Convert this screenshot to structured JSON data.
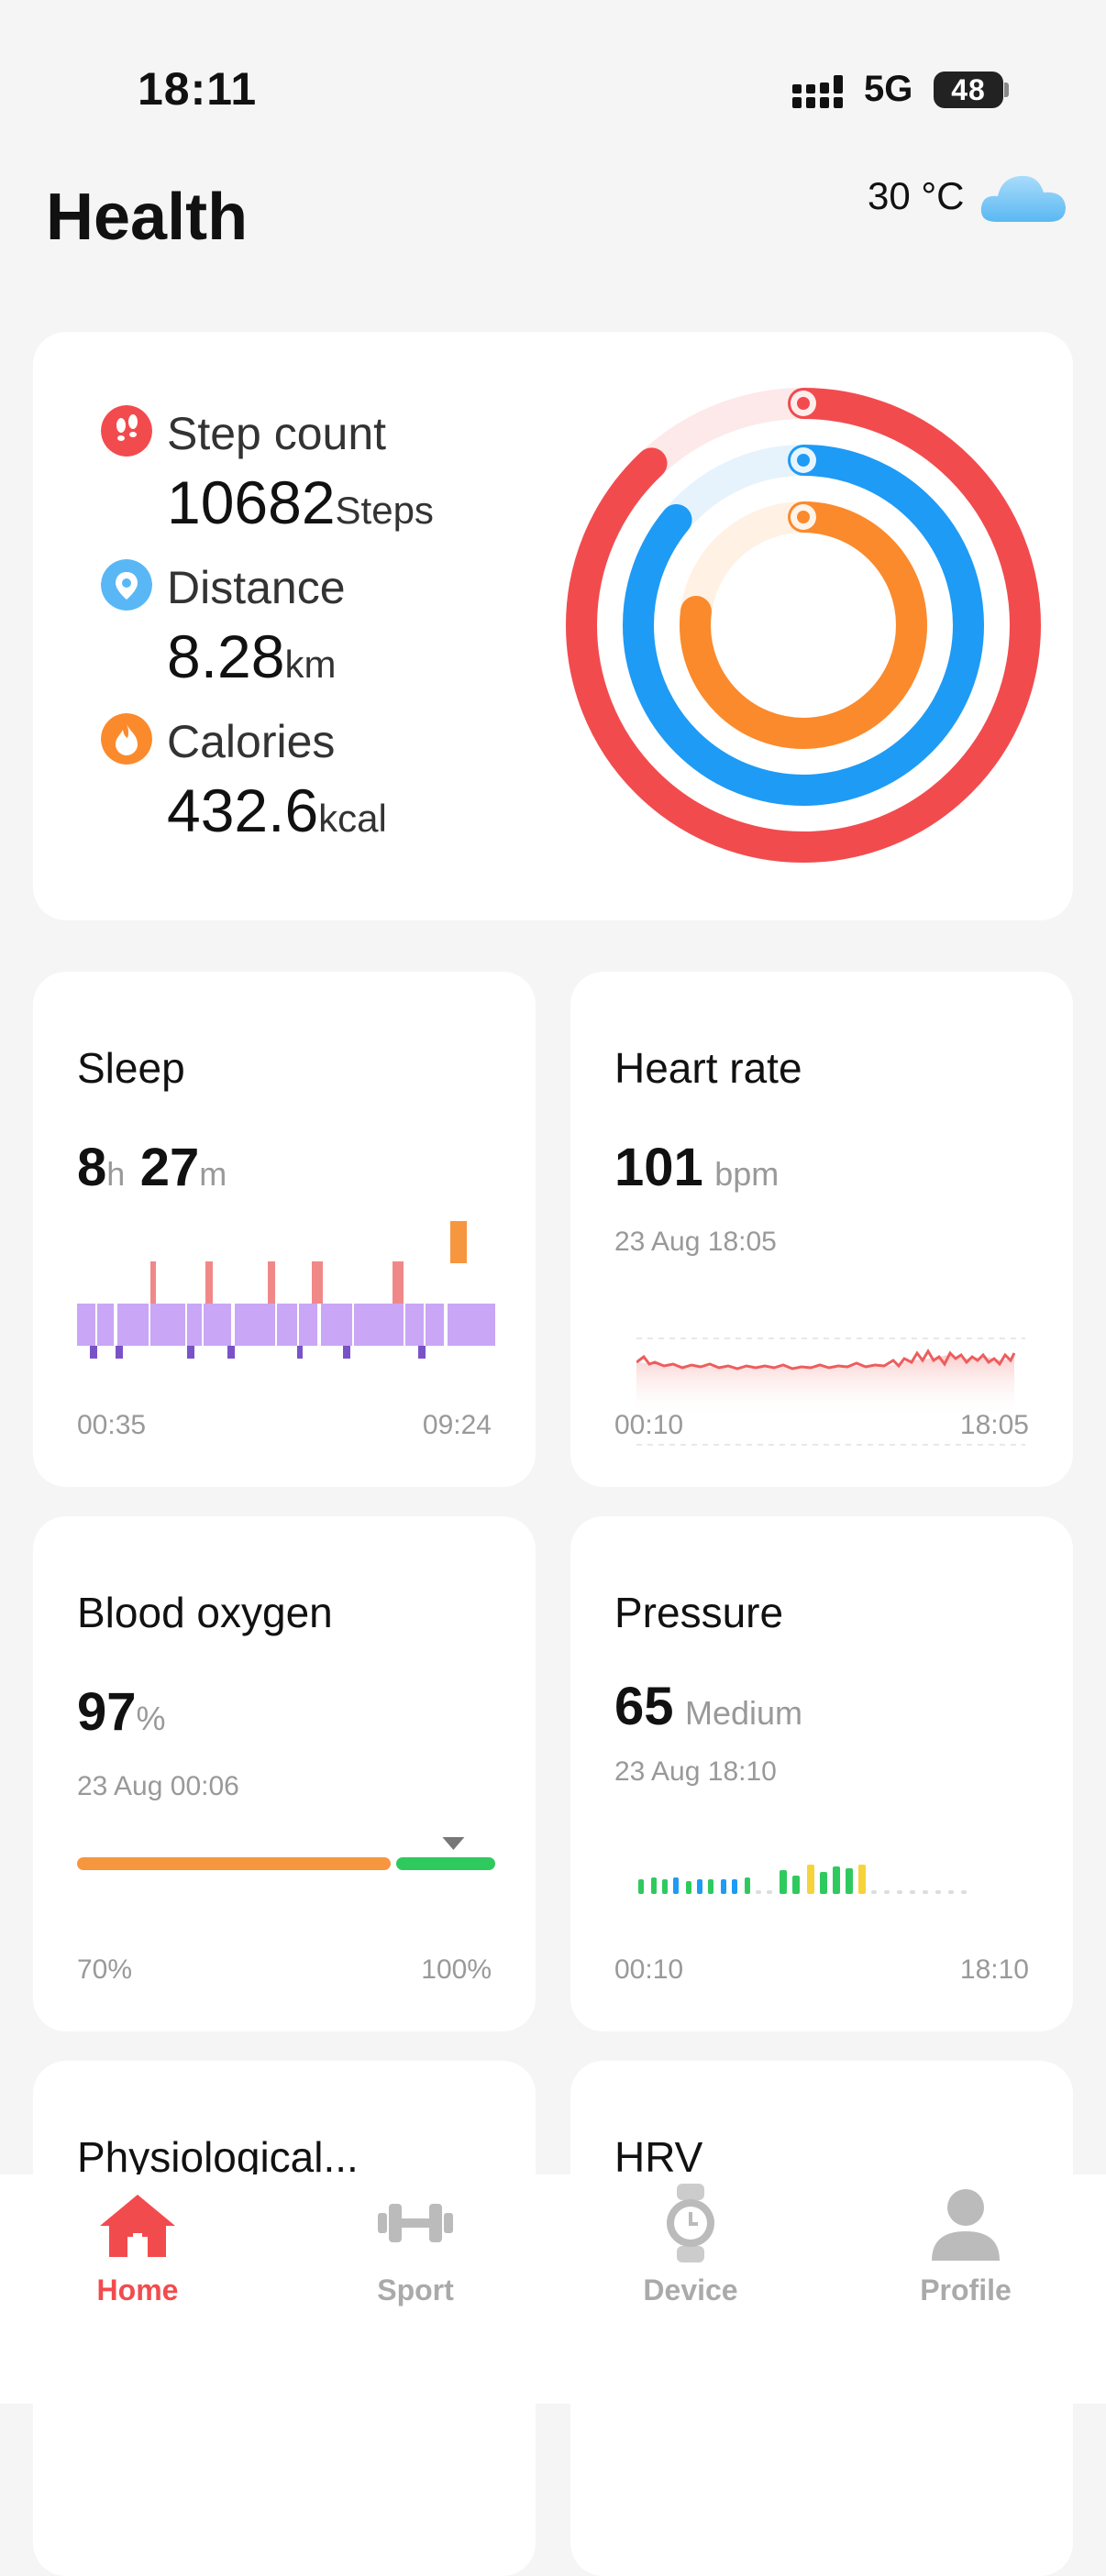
{
  "status_bar": {
    "time": "18:11",
    "network": "5G",
    "battery": "48"
  },
  "header": {
    "title": "Health",
    "temperature": "30 °C",
    "weather_icon": "cloud-icon"
  },
  "activity": {
    "steps": {
      "label": "Step count",
      "value": "10682",
      "unit": "Steps",
      "color": "#f24b4e",
      "progress": 0.88
    },
    "distance": {
      "label": "Distance",
      "value": "8.28",
      "unit": "km",
      "color": "#1e9bf5",
      "progress": 0.86
    },
    "calories": {
      "label": "Calories",
      "value": "432.6",
      "unit": "kcal",
      "color": "#fb8a2c",
      "progress": 0.77
    }
  },
  "sleep": {
    "title": "Sleep",
    "hours": "8",
    "hours_unit": "h",
    "minutes": "27",
    "minutes_unit": "m",
    "start": "00:35",
    "end": "09:24"
  },
  "heart_rate": {
    "title": "Heart rate",
    "value": "101",
    "unit": "bpm",
    "date": "23 Aug 18:05",
    "start": "00:10",
    "end": "18:05"
  },
  "blood_oxygen": {
    "title": "Blood oxygen",
    "value": "97",
    "unit": "%",
    "date": "23 Aug 00:06",
    "min_label": "70%",
    "max_label": "100%",
    "level": 0.9
  },
  "pressure": {
    "title": "Pressure",
    "value": "65",
    "level": "Medium",
    "date": "23 Aug 18:10",
    "start": "00:10",
    "end": "18:10"
  },
  "bottom_cards": {
    "left_title": "Physiological...",
    "right_title": "HRV"
  },
  "nav": {
    "items": [
      {
        "label": "Home",
        "icon": "home-icon",
        "active": true
      },
      {
        "label": "Sport",
        "icon": "dumbbell-icon",
        "active": false
      },
      {
        "label": "Device",
        "icon": "watch-icon",
        "active": false
      },
      {
        "label": "Profile",
        "icon": "person-icon",
        "active": false
      }
    ],
    "active_color": "#f24b4e",
    "inactive_color": "#aaaaaa"
  }
}
